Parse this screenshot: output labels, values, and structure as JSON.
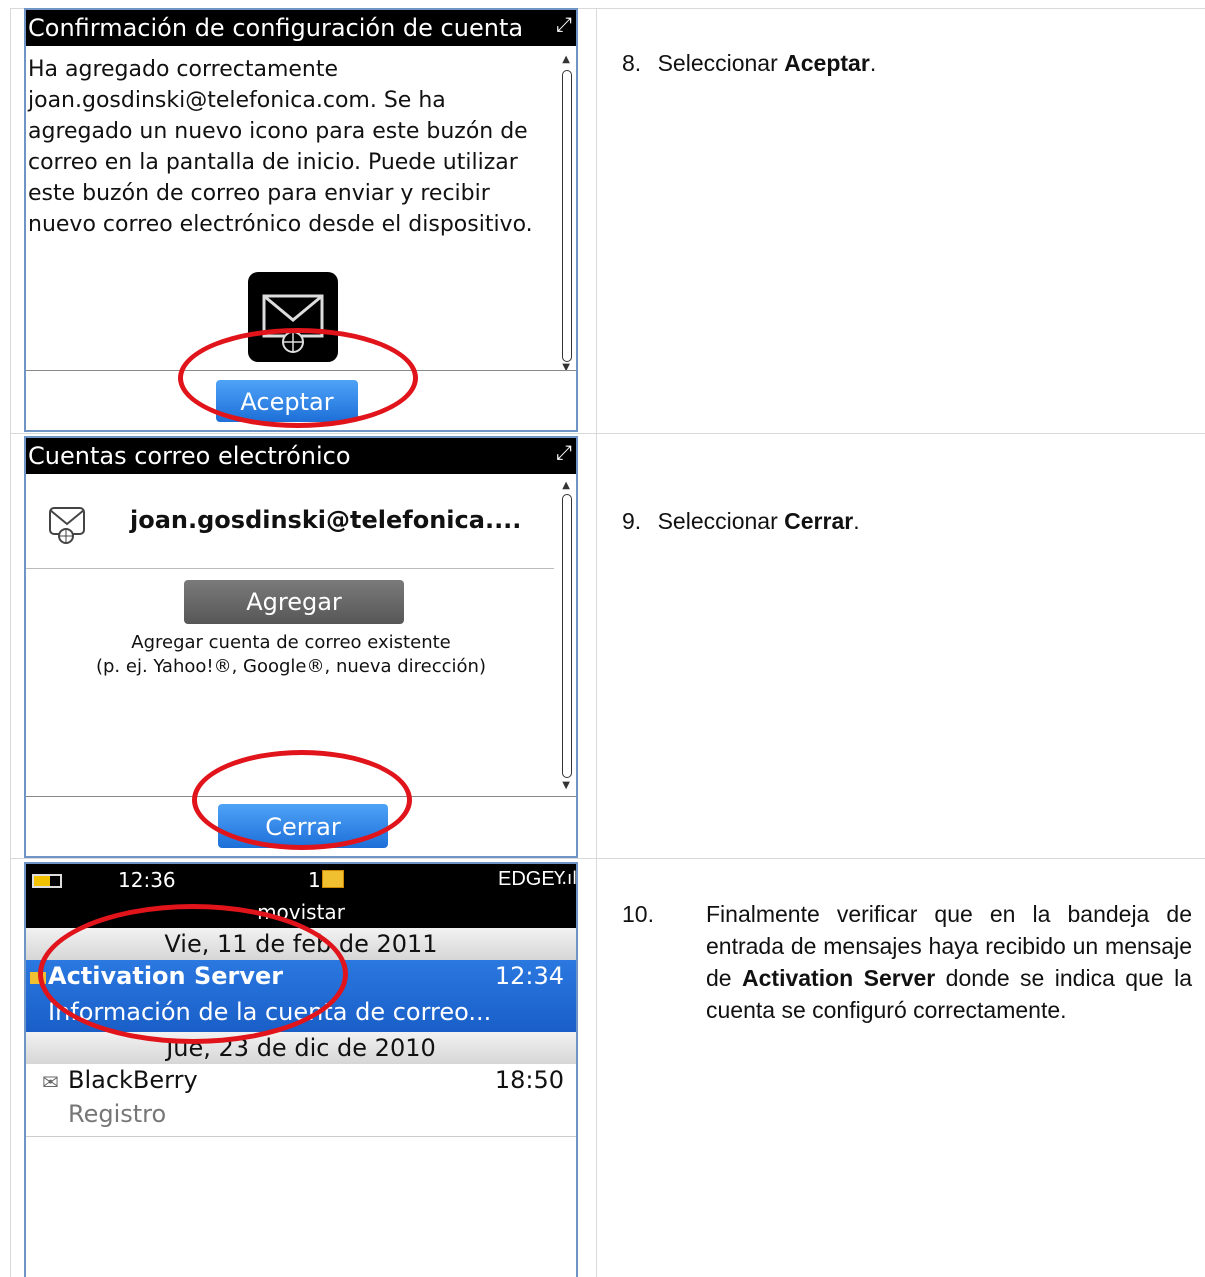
{
  "screens": {
    "confirm": {
      "title": "Confirmación de configuración de cuenta",
      "message": "Ha agregado correctamente joan.gosdinski@telefonica.com. Se ha agregado un nuevo icono para este buzón de correo en la pantalla de inicio. Puede utilizar este buzón de correo para enviar y recibir nuevo correo electrónico desde el dispositivo.",
      "accept_label": "Aceptar"
    },
    "accounts": {
      "title": "Cuentas correo electrónico",
      "account_email": "joan.gosdinski@telefonica....",
      "add_label": "Agregar",
      "add_desc_line1": "Agregar cuenta de correo existente",
      "add_desc_line2": "(p. ej. Yahoo!®, Google®, nueva dirección)",
      "close_label": "Cerrar"
    },
    "inbox": {
      "status_time": "12:36",
      "status_count": "1",
      "network": "EDGE",
      "carrier": "movistar",
      "date1": "Vie, 11 de feb de 2011",
      "msg1_sender": "Activation Server",
      "msg1_time": "12:34",
      "msg1_subject": "Información de la cuenta de correo...",
      "date2": "Jue, 23 de dic de 2010",
      "msg2_sender": "BlackBerry",
      "msg2_time": "18:50",
      "msg2_subject": "Registro"
    }
  },
  "steps": {
    "s8": {
      "number": "8.",
      "pre": "Seleccionar ",
      "bold": "Aceptar",
      "post": "."
    },
    "s9": {
      "number": "9.",
      "pre": "Seleccionar ",
      "bold": "Cerrar",
      "post": "."
    },
    "s10": {
      "number": "10.",
      "pre": "Finalmente verificar que en la bandeja de entrada de mensajes haya recibido un mensaje de ",
      "bold": "Activation Server",
      "post": " donde se indica que la cuenta se configuró correctamente."
    }
  },
  "colors": {
    "annotation": "#e0141a",
    "selection": "#1a5fc8",
    "frame": "#6f95c6"
  }
}
